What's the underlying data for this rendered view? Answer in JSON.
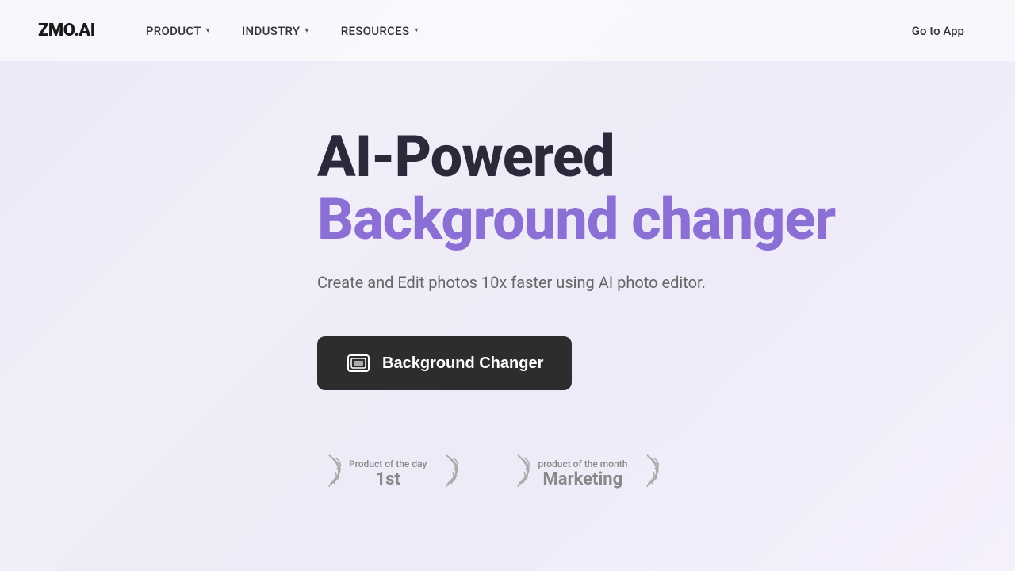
{
  "brand": {
    "logo": "ZMO.AI"
  },
  "navbar": {
    "items": [
      {
        "label": "PRODUCT",
        "id": "product"
      },
      {
        "label": "INDUSTRY",
        "id": "industry"
      },
      {
        "label": "RESOURCES",
        "id": "resources"
      }
    ],
    "cta": "Go to App"
  },
  "hero": {
    "title_line1": "AI-Powered",
    "title_line2": "Background changer",
    "subtitle": "Create and Edit photos 10x faster using AI photo editor.",
    "cta_label": "Background Changer"
  },
  "badges": [
    {
      "label": "Product of the day",
      "value": "1st"
    },
    {
      "label": "product of the month",
      "value": "Marketing"
    }
  ],
  "colors": {
    "accent": "#8b6fd4",
    "dark": "#2a2a3a",
    "button_bg": "#2d2d2d",
    "muted": "#666",
    "badge_color": "#888"
  }
}
